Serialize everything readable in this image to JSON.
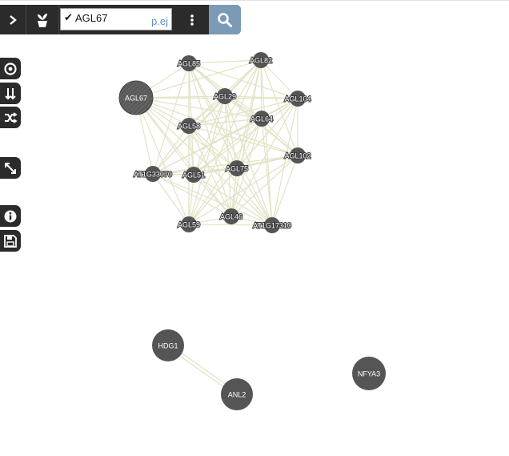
{
  "toolbar": {
    "query_value": "AGL67",
    "query_hint": "p.ej",
    "icons": {
      "expand": "chevron-right-icon",
      "gene_mode": "plant-pot-icon",
      "query_ok": "checkmark-icon",
      "menu": "kebab-menu-icon",
      "search": "search-icon"
    }
  },
  "side_buttons": [
    {
      "icon": "target-icon"
    },
    {
      "icon": "arrows-down-icon"
    },
    {
      "icon": "shuffle-icon"
    },
    {
      "icon": "resize-diagonal-icon"
    },
    {
      "icon": "info-icon"
    },
    {
      "icon": "save-icon"
    }
  ],
  "graph": {
    "colors": {
      "node": "#555555",
      "query_node": "#5a5a5a",
      "edge": "#e3e2c6"
    },
    "nodes": [
      {
        "id": "AGL67",
        "label": "AGL67",
        "query": true
      },
      {
        "id": "AGL85",
        "label": "AGL85"
      },
      {
        "id": "AGL82",
        "label": "AGL82"
      },
      {
        "id": "AGL29",
        "label": "AGL29"
      },
      {
        "id": "AGL104",
        "label": "AGL104"
      },
      {
        "id": "AGL58",
        "label": "AGL58"
      },
      {
        "id": "AGL64",
        "label": "AGL64"
      },
      {
        "id": "AGL102",
        "label": "AGL102"
      },
      {
        "id": "AT1G33070",
        "label": "AT1G33070"
      },
      {
        "id": "AGL51",
        "label": "AGL51"
      },
      {
        "id": "AGL75",
        "label": "AGL75"
      },
      {
        "id": "AGL59",
        "label": "AGL59"
      },
      {
        "id": "AGL46",
        "label": "AGL46"
      },
      {
        "id": "AT1G17310",
        "label": "AT1G17310"
      },
      {
        "id": "HDG1",
        "label": "HDG1"
      },
      {
        "id": "ANL2",
        "label": "ANL2"
      },
      {
        "id": "NFYA3",
        "label": "NFYA3"
      }
    ],
    "edges": [
      [
        "HDG1",
        "ANL2"
      ]
    ]
  }
}
